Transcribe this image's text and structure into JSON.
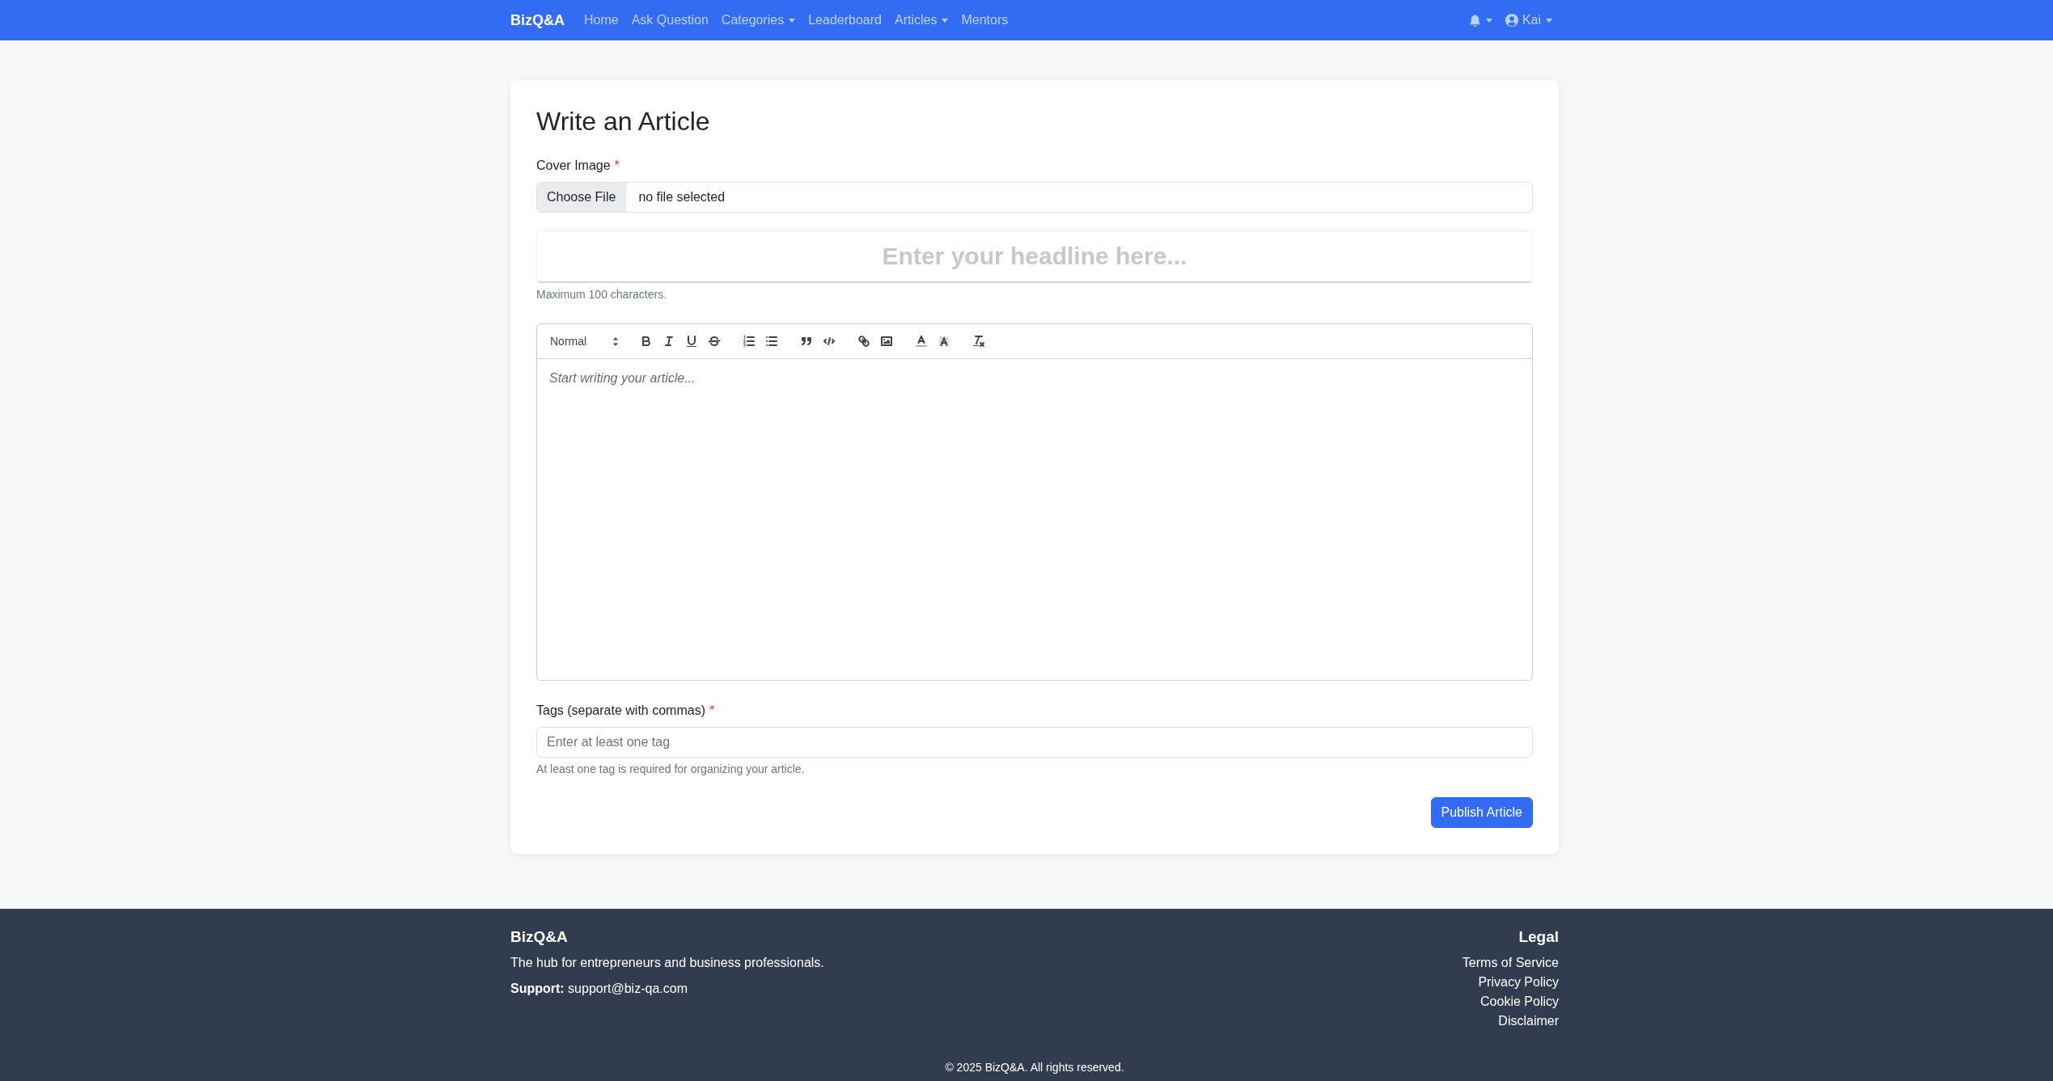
{
  "navbar": {
    "brand": "BizQ&A",
    "links": [
      {
        "label": "Home",
        "dropdown": false
      },
      {
        "label": "Ask Question",
        "dropdown": false
      },
      {
        "label": "Categories",
        "dropdown": true
      },
      {
        "label": "Leaderboard",
        "dropdown": false
      },
      {
        "label": "Articles",
        "dropdown": true
      },
      {
        "label": "Mentors",
        "dropdown": false
      }
    ],
    "menus": [
      {
        "kind": "notifications",
        "dropdown": true
      },
      {
        "kind": "user",
        "label": "Kai",
        "dropdown": true
      }
    ]
  },
  "form": {
    "title": "Write an Article",
    "cover_image": {
      "label": "Cover Image",
      "required_mark": "*",
      "button": "Choose File",
      "value": "no file selected"
    },
    "headline": {
      "placeholder": "Enter your headline here...",
      "help": "Maximum 100 characters."
    },
    "editor": {
      "format": "Normal",
      "placeholder": "Start writing your article..."
    },
    "tags": {
      "label": "Tags (separate with commas)",
      "required_mark": "*",
      "placeholder": "Enter at least one tag",
      "help": "At least one tag is required for organizing your article."
    },
    "submit": "Publish Article"
  },
  "footer": {
    "brand": "BizQ&A",
    "tagline": "The hub for entrepreneurs and business professionals.",
    "support": "**Support:** support@biz-qa.com",
    "legal": {
      "title": "Legal",
      "links": [
        "Terms of Service",
        "Privacy Policy",
        "Cookie Policy",
        "Disclaimer"
      ]
    },
    "copyright": "© 2025 BizQ&A. All rights reserved."
  }
}
